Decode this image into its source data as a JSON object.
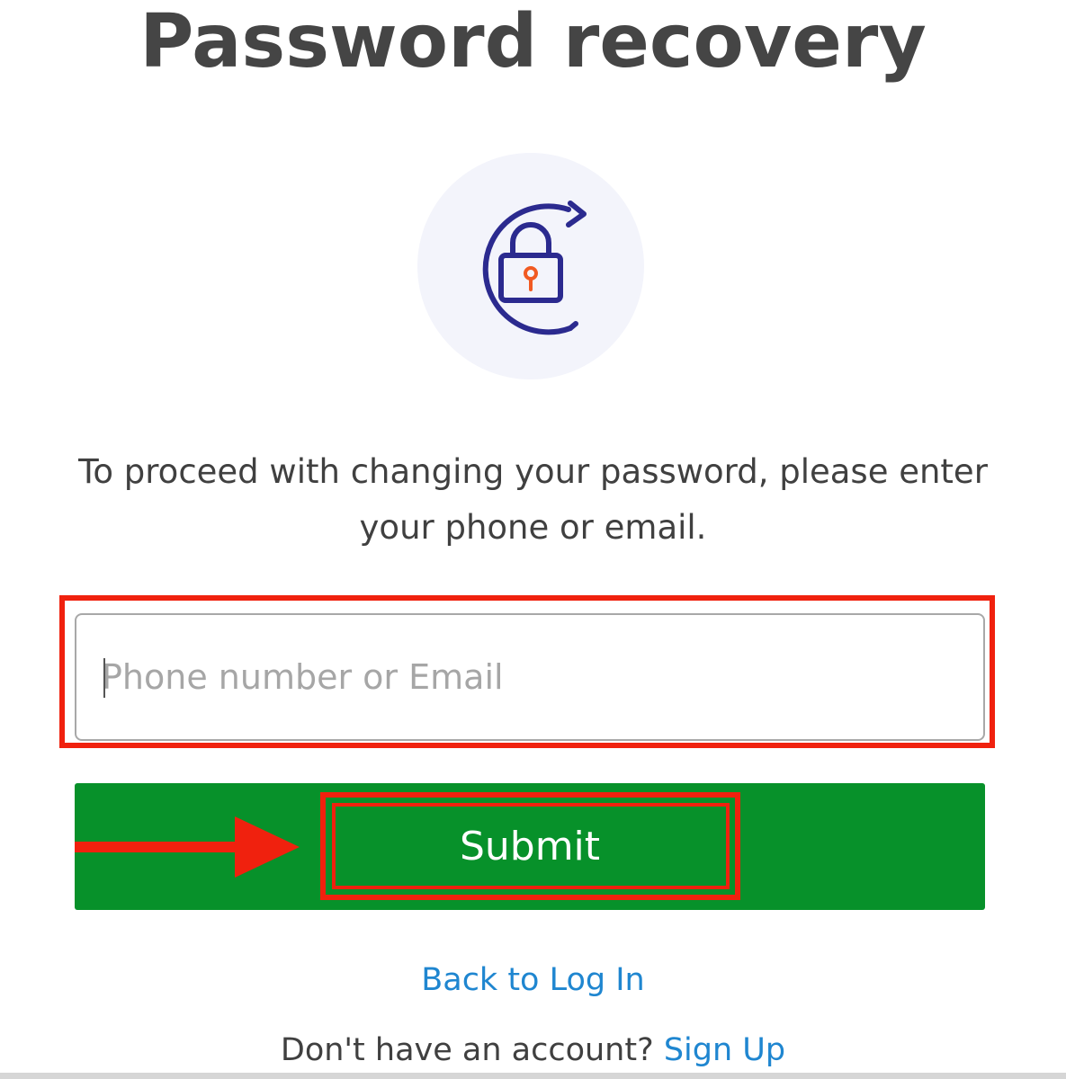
{
  "page": {
    "title": "Password recovery",
    "instruction": "To proceed with changing your password, please enter your phone or email."
  },
  "form": {
    "contact_placeholder": "Phone number or Email",
    "contact_value": "",
    "submit_label": "Submit"
  },
  "links": {
    "back_to_login": "Back to Log In",
    "no_account_prompt": "Don't have an account?",
    "sign_up": "Sign Up"
  },
  "icons": {
    "recovery": "lock-refresh-icon",
    "arrow": "right-arrow-icon"
  },
  "colors": {
    "primary": "#07912a",
    "link": "#1f86d0",
    "highlight": "#f0210e",
    "icon_stroke": "#2b2a8f",
    "icon_keyhole": "#f15a22"
  }
}
